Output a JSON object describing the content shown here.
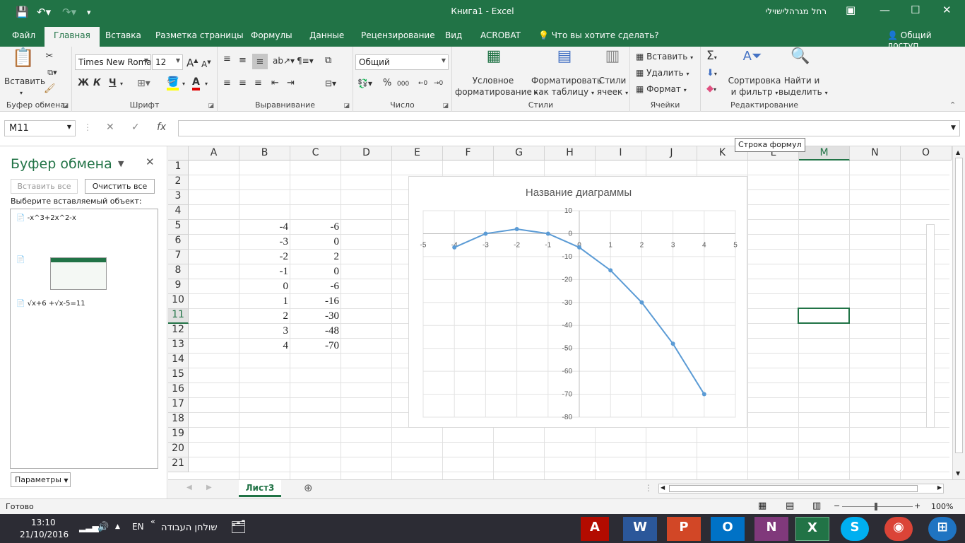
{
  "window": {
    "title": "Книга1  -  Excel",
    "user": "רחל מגרהלישוילי"
  },
  "menu": {
    "tabs": [
      "Файл",
      "Главная",
      "Вставка",
      "Разметка страницы",
      "Формулы",
      "Данные",
      "Рецензирование",
      "Вид",
      "ACROBAT"
    ],
    "active": "Главная",
    "tell_me": "Что вы хотите сделать?",
    "share": "Общий доступ"
  },
  "ribbon": {
    "clipboard": {
      "paste": "Вставить",
      "label": "Буфер обмена"
    },
    "font": {
      "name": "Times New Roma",
      "size": "12",
      "bold": "Ж",
      "italic": "К",
      "underline": "Ч",
      "label": "Шрифт"
    },
    "alignment": {
      "label": "Выравнивание"
    },
    "number": {
      "format": "Общий",
      "label": "Число"
    },
    "styles": {
      "conditional_1": "Условное",
      "conditional_2": "форматирование",
      "table_1": "Форматировать",
      "table_2": "как таблицу",
      "cell_1": "Стили",
      "cell_2": "ячеек",
      "label": "Стили"
    },
    "cells": {
      "insert": "Вставить",
      "delete": "Удалить",
      "format": "Формат",
      "label": "Ячейки"
    },
    "editing": {
      "sort_1": "Сортировка",
      "sort_2": "и фильтр",
      "find_1": "Найти и",
      "find_2": "выделить",
      "label": "Редактирование"
    }
  },
  "formula_bar": {
    "name_box": "M11",
    "tooltip": "Строка формул",
    "fx": "fx"
  },
  "clipboard_pane": {
    "title": "Буфер обмена",
    "paste_all": "Вставить все",
    "clear_all": "Очистить все",
    "prompt": "Выберите вставляемый объект:",
    "items": [
      "-x^3+2x^2-x",
      "√x+6 +√x-5=11"
    ],
    "options": "Параметры"
  },
  "sheet": {
    "columns": [
      "A",
      "B",
      "C",
      "D",
      "E",
      "F",
      "G",
      "H",
      "I",
      "J",
      "K",
      "L",
      "M",
      "N",
      "O"
    ],
    "rows": [
      "1",
      "2",
      "3",
      "4",
      "5",
      "6",
      "7",
      "8",
      "9",
      "10",
      "11",
      "12",
      "13",
      "14",
      "15",
      "16",
      "17",
      "18",
      "19",
      "20",
      "21"
    ],
    "selected_col": "M",
    "selected_row": "11",
    "data": [
      {
        "row": "5",
        "b": "-4",
        "c": "-6"
      },
      {
        "row": "6",
        "b": "-3",
        "c": "0"
      },
      {
        "row": "7",
        "b": "-2",
        "c": "2"
      },
      {
        "row": "8",
        "b": "-1",
        "c": "0"
      },
      {
        "row": "9",
        "b": "0",
        "c": "-6"
      },
      {
        "row": "10",
        "b": "1",
        "c": "-16"
      },
      {
        "row": "11",
        "b": "2",
        "c": "-30"
      },
      {
        "row": "12",
        "b": "3",
        "c": "-48"
      },
      {
        "row": "13",
        "b": "4",
        "c": "-70"
      }
    ],
    "tab": "Лист3"
  },
  "chart_data": {
    "type": "scatter",
    "title": "Название диаграммы",
    "x": [
      -4,
      -3,
      -2,
      -1,
      0,
      1,
      2,
      3,
      4
    ],
    "y": [
      -6,
      0,
      2,
      0,
      -6,
      -16,
      -30,
      -48,
      -70
    ],
    "xlim": [
      -5,
      5
    ],
    "ylim": [
      -80,
      10
    ],
    "xticks": [
      "-5",
      "-4",
      "-3",
      "-2",
      "-1",
      "0",
      "1",
      "2",
      "3",
      "4",
      "5"
    ],
    "yticks": [
      "10",
      "0",
      "-10",
      "-20",
      "-30",
      "-40",
      "-50",
      "-60",
      "-70",
      "-80"
    ],
    "color": "#5b9bd5",
    "grid": true
  },
  "status": {
    "ready": "Готово",
    "zoom": "100%"
  },
  "taskbar": {
    "time": "13:10",
    "date": "21/10/2016",
    "lang": "EN",
    "desktop": "שולחן העבודה"
  }
}
